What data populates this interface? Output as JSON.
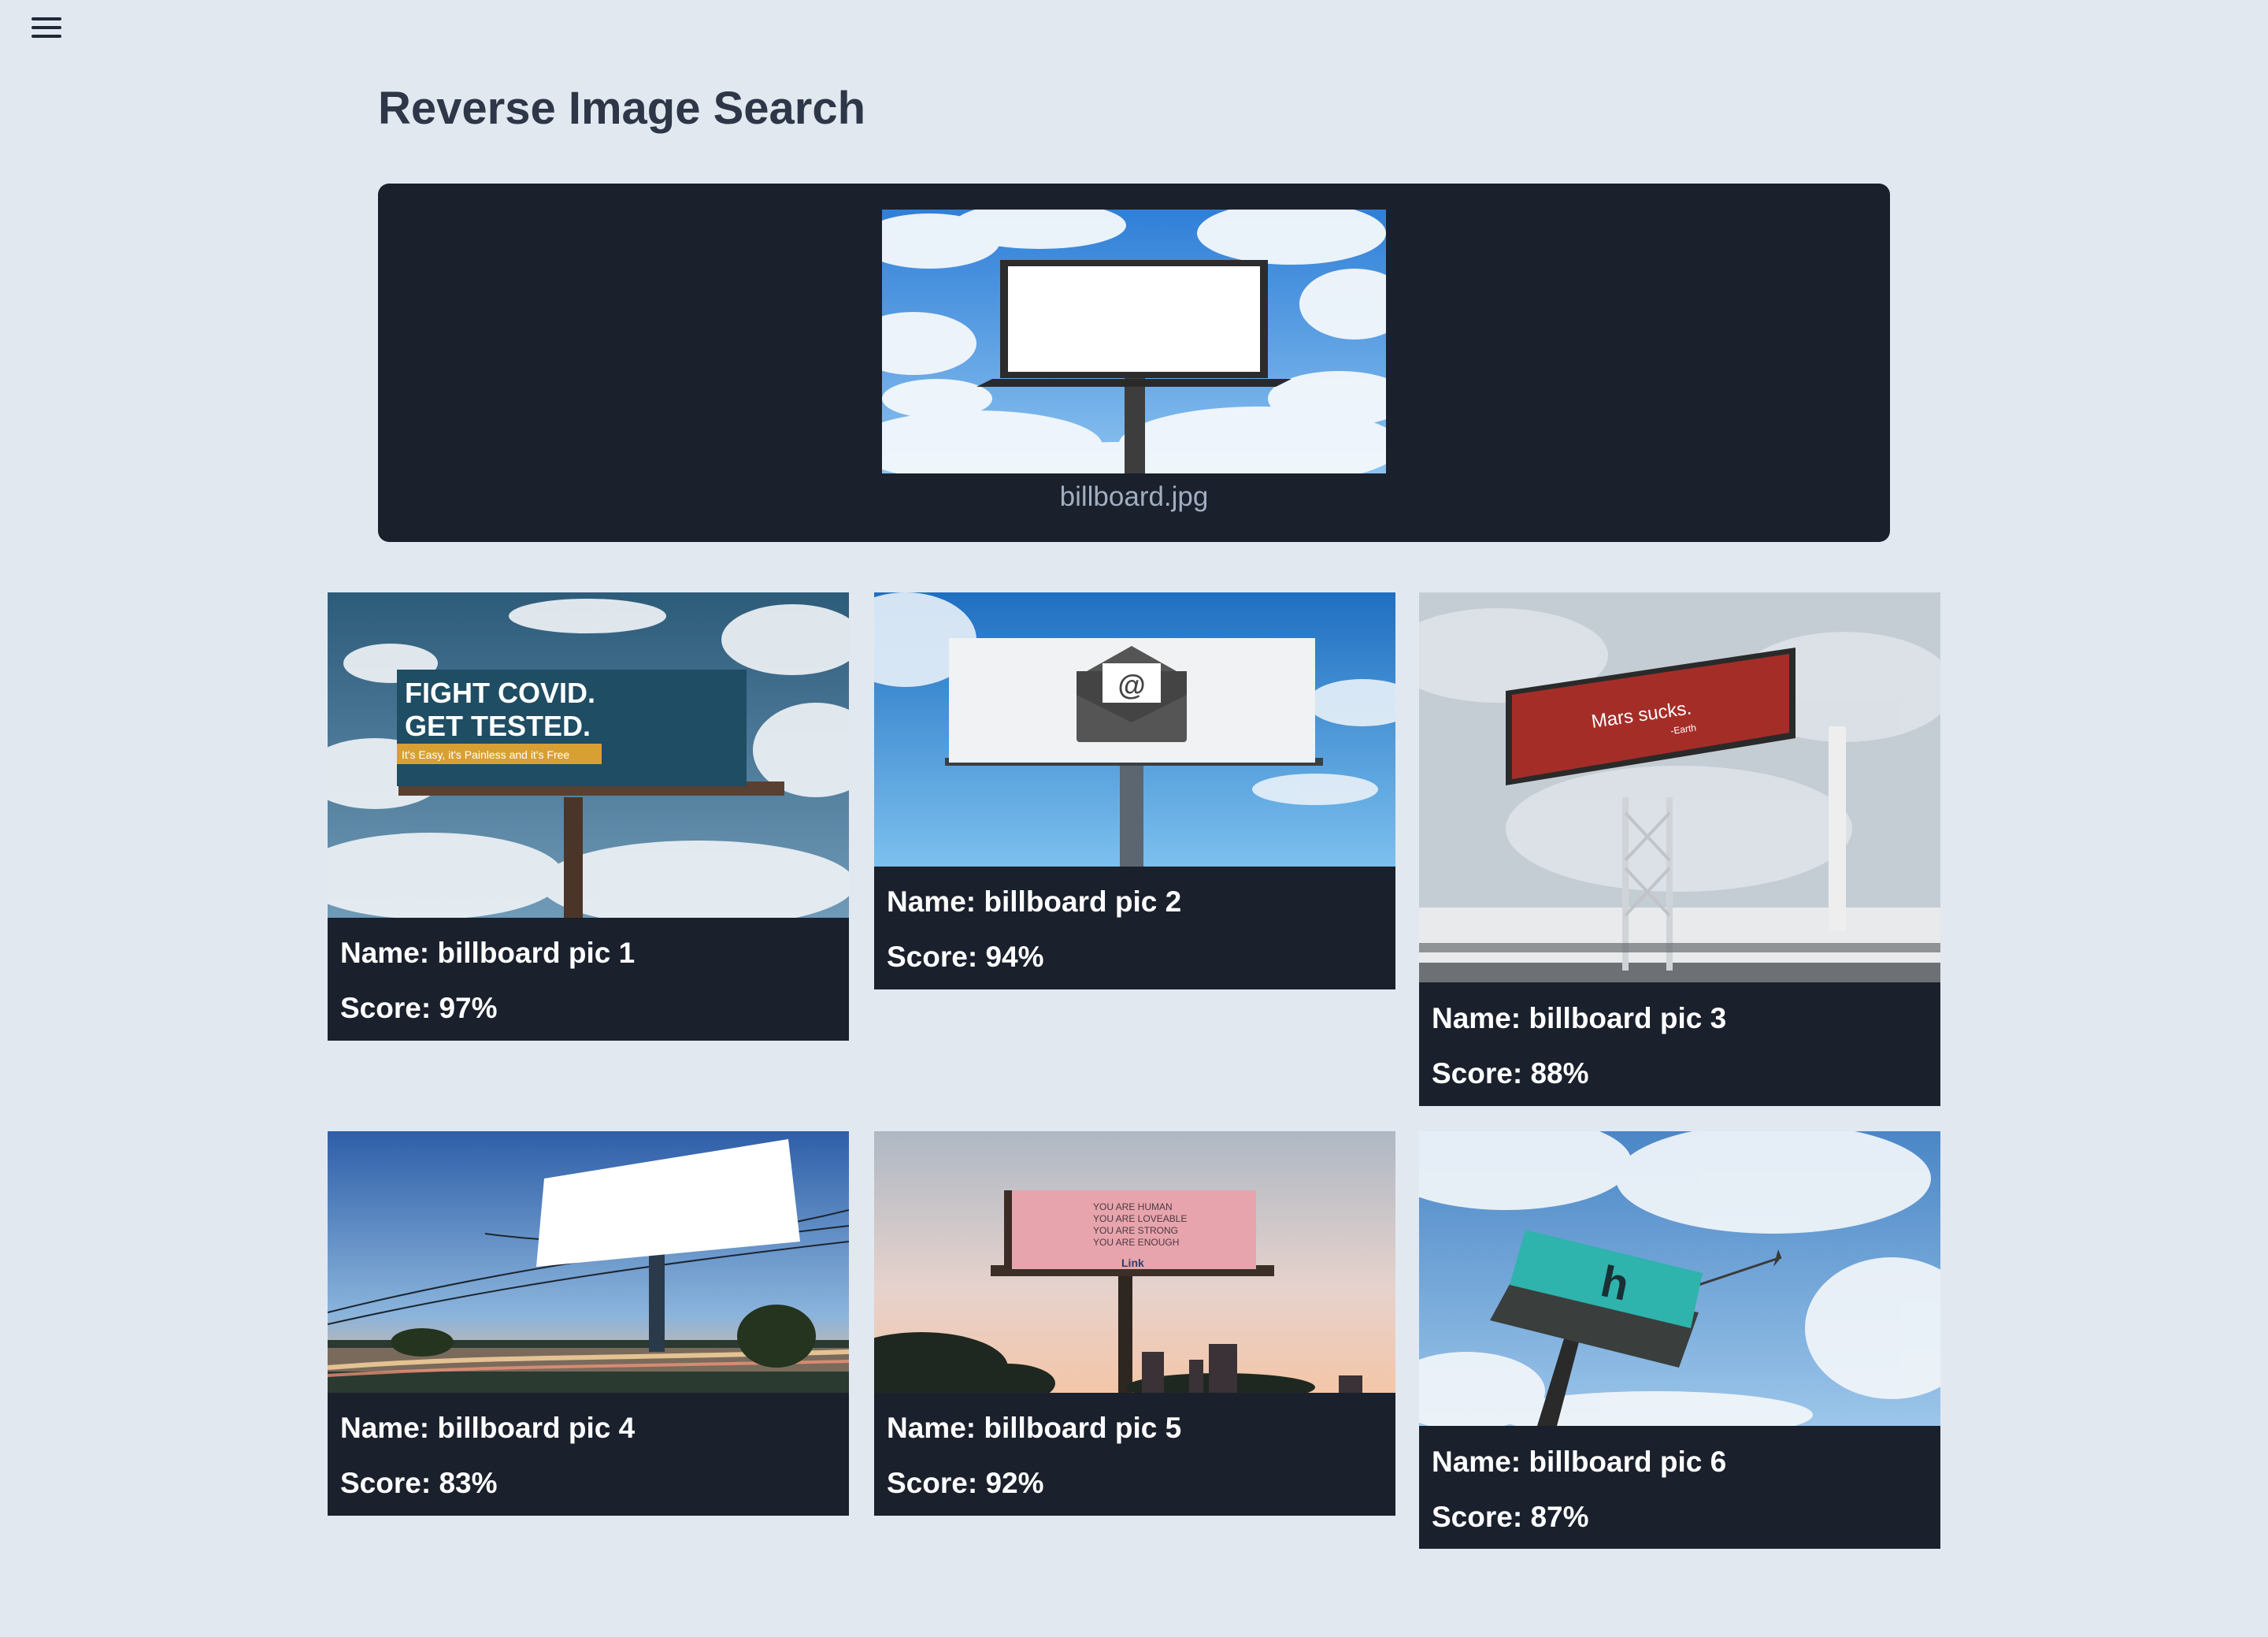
{
  "page": {
    "title": "Reverse Image Search",
    "menu_icon": "hamburger-menu-icon"
  },
  "query": {
    "filename": "billboard.jpg"
  },
  "labels": {
    "name_prefix": "Name: ",
    "score_prefix": "Score: "
  },
  "results": [
    {
      "name": "billboard pic 1",
      "score": "97%",
      "billboard_text": [
        "FIGHT COVID.",
        "GET TESTED.",
        "It's Easy, it's Painless and it's Free"
      ]
    },
    {
      "name": "billboard pic 2",
      "score": "94%",
      "billboard_text": []
    },
    {
      "name": "billboard pic 3",
      "score": "88%",
      "billboard_text": [
        "Mars sucks.",
        "-Earth"
      ]
    },
    {
      "name": "billboard pic 4",
      "score": "83%",
      "billboard_text": []
    },
    {
      "name": "billboard pic 5",
      "score": "92%",
      "billboard_text": [
        "YOU ARE HUMAN",
        "YOU ARE LOVEABLE",
        "YOU ARE STRONG",
        "YOU ARE ENOUGH",
        "Link"
      ]
    },
    {
      "name": "billboard pic 6",
      "score": "87%",
      "billboard_text": [
        "h"
      ]
    }
  ],
  "colors": {
    "background": "#e2e8f0",
    "panel": "#1a202c",
    "title": "#2d3748",
    "caption": "#a0aec0"
  }
}
